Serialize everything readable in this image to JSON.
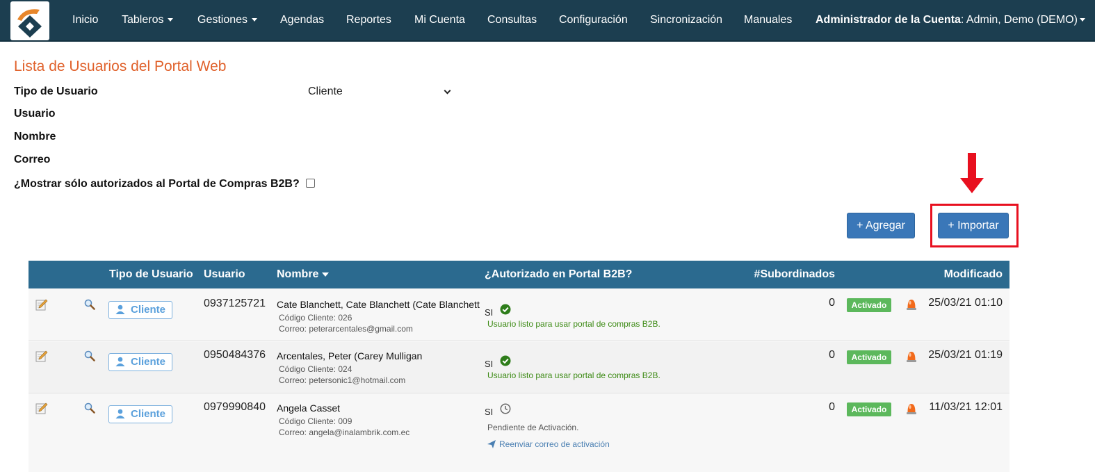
{
  "nav": {
    "items": [
      "Inicio",
      "Tableros",
      "Gestiones",
      "Agendas",
      "Reportes",
      "Mi Cuenta",
      "Consultas",
      "Configuración",
      "Sincronización",
      "Manuales"
    ],
    "account_label": "Administrador de la Cuenta",
    "account_user": ": Admin, Demo (DEMO)"
  },
  "form": {
    "title": "Lista de Usuarios del Portal Web",
    "tipo_label": "Tipo de Usuario",
    "tipo_value": "Cliente",
    "usuario_label": "Usuario",
    "nombre_label": "Nombre",
    "correo_label": "Correo",
    "b2b_label": "¿Mostrar sólo autorizados al Portal de Compras B2B?",
    "b2b_checked": false
  },
  "buttons": {
    "add": "+ Agregar",
    "import": "+ Importar"
  },
  "table": {
    "headers": {
      "tipo": "Tipo de Usuario",
      "usuario": "Usuario",
      "nombre": "Nombre",
      "autorizado": "¿Autorizado en Portal B2B?",
      "subordinados": "#Subordinados",
      "modificado": "Modificado"
    },
    "rows": [
      {
        "tipo": "Cliente",
        "usuario": "0937125721",
        "nombre": "Cate Blanchett, Cate Blanchett (Cate Blanchett",
        "codigo": "Código Cliente: 026",
        "correo": "Correo: peterarcentales@gmail.com",
        "si": "SI",
        "status": "ok",
        "status_msg": "Usuario listo para usar portal de compras B2B.",
        "subordinados": "0",
        "estado": "Activado",
        "modificado": "25/03/21 01:10"
      },
      {
        "tipo": "Cliente",
        "usuario": "0950484376",
        "nombre": "Arcentales, Peter (Carey Mulligan",
        "codigo": "Código Cliente: 024",
        "correo": "Correo: petersonic1@hotmail.com",
        "si": "SI",
        "status": "ok",
        "status_msg": "Usuario listo para usar portal de compras B2B.",
        "subordinados": "0",
        "estado": "Activado",
        "modificado": "25/03/21 01:19"
      },
      {
        "tipo": "Cliente",
        "usuario": "0979990840",
        "nombre": "Angela Casset",
        "codigo": "Código Cliente: 009",
        "correo": "Correo: angela@inalambrik.com.ec",
        "si": "SI",
        "status": "pending",
        "status_msg": "Pendiente de Activación.",
        "resend": "Reenviar correo de activación",
        "subordinados": "0",
        "estado": "Activado",
        "modificado": "11/03/21 12:01"
      }
    ]
  },
  "colors": {
    "navbar": "#1c3e50",
    "title": "#e0612b",
    "table_header": "#2b6a8f",
    "button": "#3a77b8",
    "active_badge": "#5cb85c",
    "highlight": "#e8101f"
  },
  "icons": {
    "logo": "company-logo",
    "edit": "edit-pencil-icon",
    "view": "magnifier-icon",
    "user": "user-icon",
    "ok": "check-circle-icon",
    "pending": "clock-icon",
    "send": "paper-plane-icon",
    "alarm": "alarm-light-icon",
    "annotation": "red-arrow-down-icon"
  }
}
